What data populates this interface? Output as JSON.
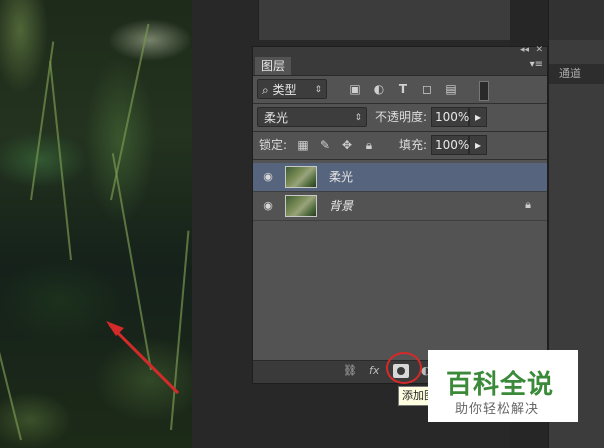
{
  "layers_panel": {
    "tab_label": "图层",
    "filter": {
      "selected": "类型"
    },
    "blend_mode": {
      "selected": "柔光"
    },
    "opacity": {
      "label": "不透明度:",
      "value": "100%"
    },
    "lock": {
      "label": "锁定:"
    },
    "fill": {
      "label": "填充:",
      "value": "100%"
    },
    "layers": [
      {
        "name": "柔光",
        "selected": true
      },
      {
        "name": "背景",
        "selected": false,
        "locked": true
      }
    ],
    "tooltip": "添加图"
  },
  "right_dock": {
    "tab_label": "通道"
  },
  "watermark": {
    "title": "百科全说",
    "subtitle": "助你轻松解决"
  },
  "colors": {
    "selected_row": "#56657d",
    "panel_bg": "#535353",
    "highlight": "#d42a2a",
    "watermark_green": "#3a8a3a"
  }
}
